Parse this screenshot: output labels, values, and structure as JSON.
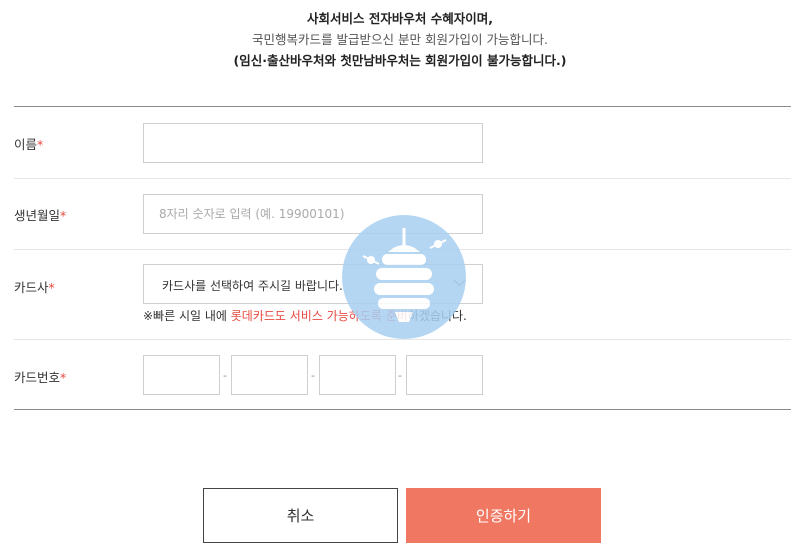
{
  "notice": {
    "line1": "사회서비스 전자바우처 수혜자이며,",
    "line2_card": "국민행복카드",
    "line2_rest": "를 발급받으신 분만 회원가입이 가능합니다.",
    "line3": "(임신·출산바우처와 첫만남바우처는 회원가입이 불가능합니다.)"
  },
  "form": {
    "required_mark": "*",
    "name": {
      "label": "이름",
      "value": "",
      "placeholder": ""
    },
    "birth": {
      "label": "생년월일",
      "value": "",
      "placeholder": "8자리 숫자로 입력 (예. 19900101)"
    },
    "card_company": {
      "label": "카드사",
      "selected": "카드사를 선택하여 주시길 바랍니다.",
      "hint_prefix": "※빠른 시일 내에 ",
      "hint_highlight": "롯데카드도 서비스 가능하도록 준비",
      "hint_suffix": "하겠습니다."
    },
    "card_number": {
      "label": "카드번호",
      "separator": "-",
      "parts": [
        "",
        "",
        "",
        ""
      ]
    }
  },
  "buttons": {
    "cancel": "취소",
    "confirm": "인증하기"
  },
  "colors": {
    "accent": "#f07762",
    "required": "#e8493f",
    "watermark": "#9ec8ee"
  },
  "icons": {
    "watermark": "beehive-icon",
    "select_arrow": "chevron-down-icon"
  }
}
